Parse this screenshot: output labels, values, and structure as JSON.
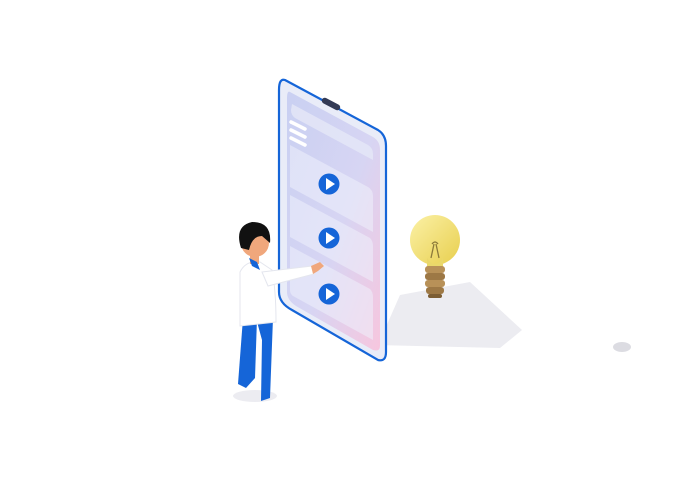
{
  "scene": {
    "subject": "",
    "colors": {
      "phone_frame": "#1565d8",
      "phone_screen_top": "#c9d0f2",
      "phone_screen_bottom": "#f7c6de",
      "card_fill": "#eef0fb",
      "play_button": "#1565d8",
      "play_glyph": "#ffffff",
      "shadow": "#ececf1",
      "bulb_glass": "#f3e27a",
      "bulb_base": "#a8814c",
      "person_hair": "#111111",
      "person_skin": "#f0a77c",
      "person_shirt": "#ffffff",
      "person_pants": "#1565d8"
    },
    "icons": [
      "smartphone-icon",
      "play-button-icon",
      "light-bulb-icon",
      "person-icon"
    ],
    "video_cards": [
      {
        "icon": "play-button-icon"
      },
      {
        "icon": "play-button-icon"
      },
      {
        "icon": "play-button-icon"
      }
    ]
  }
}
